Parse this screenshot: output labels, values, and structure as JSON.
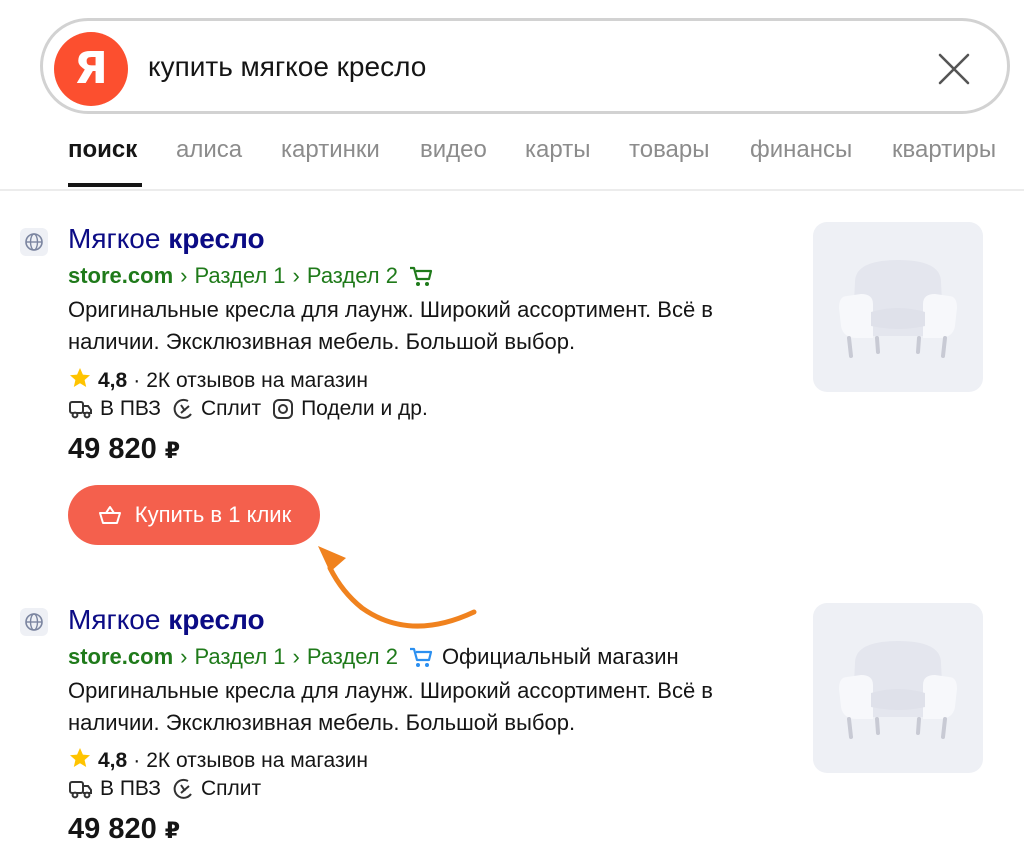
{
  "search": {
    "logo_letter": "Я",
    "query": "купить мягкое кресло"
  },
  "tabs": [
    {
      "label": "поиск",
      "active": true
    },
    {
      "label": "алиса"
    },
    {
      "label": "картинки"
    },
    {
      "label": "видео"
    },
    {
      "label": "карты"
    },
    {
      "label": "товары"
    },
    {
      "label": "финансы"
    },
    {
      "label": "квартиры"
    }
  ],
  "results": [
    {
      "title_plain": "Мягкое ",
      "title_bold": "кресло",
      "domain": "store.com",
      "crumb_1": "Раздел 1",
      "crumb_2": "Раздел 2",
      "crumb_sep": "›",
      "official": "",
      "description": "Оригинальные кресла для лаунж. Широкий ассортимент. Всё в наличии. Эксклюзивная мебель. Большой выбор.",
      "rating": "4,8",
      "rating_dot": "·",
      "reviews": "2К отзывов на магазин",
      "features": [
        "В ПВЗ",
        "Сплит",
        "Подели и др."
      ],
      "price": "49 820",
      "currency": "₽",
      "buy_label": "Купить в 1 клик"
    },
    {
      "title_plain": "Мягкое ",
      "title_bold": "кресло",
      "domain": "store.com",
      "crumb_1": "Раздел 1",
      "crumb_2": "Раздел 2",
      "crumb_sep": "›",
      "official": "Официальный магазин",
      "description": "Оригинальные кресла для лаунж. Широкий ассортимент. Всё в наличии. Эксклюзивная мебель. Большой выбор.",
      "rating": "4,8",
      "rating_dot": "·",
      "reviews": "2К отзывов на магазин",
      "features": [
        "В ПВЗ",
        "Сплит"
      ],
      "price": "49 820",
      "currency": "₽"
    }
  ],
  "colors": {
    "accent": "#f4604d",
    "logo": "#fc4f2f",
    "title_link": "#0b0b85",
    "url_green": "#1f7a1a",
    "cart_green": "#1f7a1a",
    "cart_blue": "#2b8ff0",
    "arrow": "#f0821e"
  },
  "icons": [
    "search-clear-icon",
    "globe-icon",
    "cart-icon",
    "star-icon",
    "delivery-truck-icon",
    "split-icon",
    "podeli-icon",
    "basket-icon",
    "armchair-image",
    "pointer-arrow"
  ]
}
